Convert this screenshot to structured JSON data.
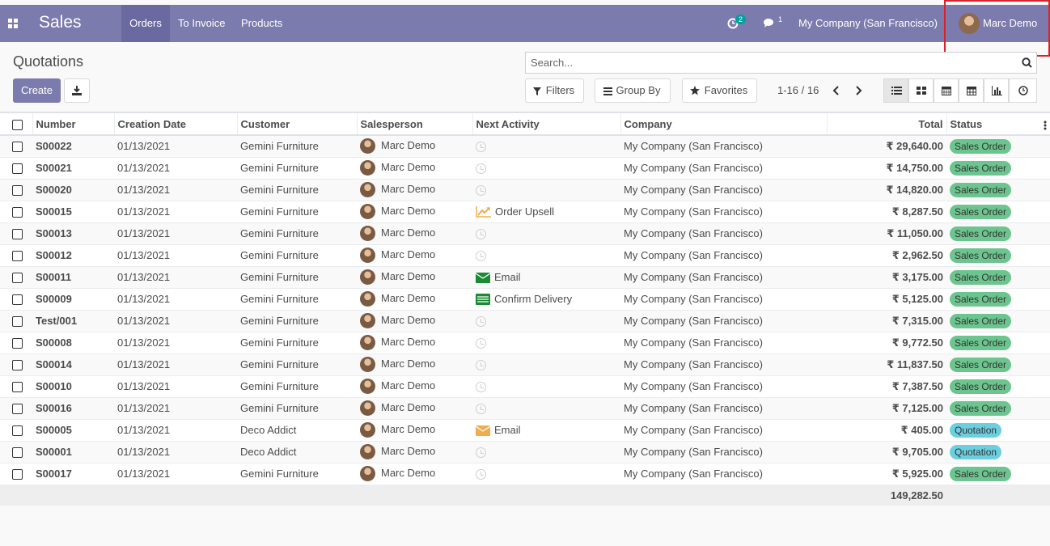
{
  "nav": {
    "app_name": "Sales",
    "menu": [
      "Orders",
      "To Invoice",
      "Products"
    ],
    "activity_count": "2",
    "message_count": "1",
    "company": "My Company (San Francisco)",
    "user": "Marc Demo"
  },
  "control": {
    "breadcrumb": "Quotations",
    "create_label": "Create",
    "search_placeholder": "Search...",
    "filters_label": "Filters",
    "groupby_label": "Group By",
    "favorites_label": "Favorites",
    "pager": "1-16 / 16"
  },
  "table": {
    "headers": [
      "Number",
      "Creation Date",
      "Customer",
      "Salesperson",
      "Next Activity",
      "Company",
      "Total",
      "Status"
    ],
    "rows": [
      {
        "number": "S00022",
        "date": "01/13/2021",
        "customer": "Gemini Furniture",
        "salesperson": "Marc Demo",
        "activity": "",
        "activity_icon": "clock-icon",
        "company": "My Company (San Francisco)",
        "total": "₹ 29,640.00",
        "status": "Sales Order"
      },
      {
        "number": "S00021",
        "date": "01/13/2021",
        "customer": "Gemini Furniture",
        "salesperson": "Marc Demo",
        "activity": "",
        "activity_icon": "clock-icon",
        "company": "My Company (San Francisco)",
        "total": "₹ 14,750.00",
        "status": "Sales Order"
      },
      {
        "number": "S00020",
        "date": "01/13/2021",
        "customer": "Gemini Furniture",
        "salesperson": "Marc Demo",
        "activity": "",
        "activity_icon": "clock-icon",
        "company": "My Company (San Francisco)",
        "total": "₹ 14,820.00",
        "status": "Sales Order"
      },
      {
        "number": "S00015",
        "date": "01/13/2021",
        "customer": "Gemini Furniture",
        "salesperson": "Marc Demo",
        "activity": "Order Upsell",
        "activity_icon": "upsell-chart-icon",
        "company": "My Company (San Francisco)",
        "total": "₹ 8,287.50",
        "status": "Sales Order"
      },
      {
        "number": "S00013",
        "date": "01/13/2021",
        "customer": "Gemini Furniture",
        "salesperson": "Marc Demo",
        "activity": "",
        "activity_icon": "clock-icon",
        "company": "My Company (San Francisco)",
        "total": "₹ 11,050.00",
        "status": "Sales Order"
      },
      {
        "number": "S00012",
        "date": "01/13/2021",
        "customer": "Gemini Furniture",
        "salesperson": "Marc Demo",
        "activity": "",
        "activity_icon": "clock-icon",
        "company": "My Company (San Francisco)",
        "total": "₹ 2,962.50",
        "status": "Sales Order"
      },
      {
        "number": "S00011",
        "date": "01/13/2021",
        "customer": "Gemini Furniture",
        "salesperson": "Marc Demo",
        "activity": "Email",
        "activity_icon": "email-green-icon",
        "company": "My Company (San Francisco)",
        "total": "₹ 3,175.00",
        "status": "Sales Order"
      },
      {
        "number": "S00009",
        "date": "01/13/2021",
        "customer": "Gemini Furniture",
        "salesperson": "Marc Demo",
        "activity": "Confirm Delivery",
        "activity_icon": "delivery-icon",
        "company": "My Company (San Francisco)",
        "total": "₹ 5,125.00",
        "status": "Sales Order"
      },
      {
        "number": "Test/001",
        "date": "01/13/2021",
        "customer": "Gemini Furniture",
        "salesperson": "Marc Demo",
        "activity": "",
        "activity_icon": "clock-icon",
        "company": "My Company (San Francisco)",
        "total": "₹ 7,315.00",
        "status": "Sales Order"
      },
      {
        "number": "S00008",
        "date": "01/13/2021",
        "customer": "Gemini Furniture",
        "salesperson": "Marc Demo",
        "activity": "",
        "activity_icon": "clock-icon",
        "company": "My Company (San Francisco)",
        "total": "₹ 9,772.50",
        "status": "Sales Order"
      },
      {
        "number": "S00014",
        "date": "01/13/2021",
        "customer": "Gemini Furniture",
        "salesperson": "Marc Demo",
        "activity": "",
        "activity_icon": "clock-icon",
        "company": "My Company (San Francisco)",
        "total": "₹ 11,837.50",
        "status": "Sales Order"
      },
      {
        "number": "S00010",
        "date": "01/13/2021",
        "customer": "Gemini Furniture",
        "salesperson": "Marc Demo",
        "activity": "",
        "activity_icon": "clock-icon",
        "company": "My Company (San Francisco)",
        "total": "₹ 7,387.50",
        "status": "Sales Order"
      },
      {
        "number": "S00016",
        "date": "01/13/2021",
        "customer": "Gemini Furniture",
        "salesperson": "Marc Demo",
        "activity": "",
        "activity_icon": "clock-icon",
        "company": "My Company (San Francisco)",
        "total": "₹ 7,125.00",
        "status": "Sales Order"
      },
      {
        "number": "S00005",
        "date": "01/13/2021",
        "customer": "Deco Addict",
        "salesperson": "Marc Demo",
        "activity": "Email",
        "activity_icon": "email-orange-icon",
        "company": "My Company (San Francisco)",
        "total": "₹ 405.00",
        "status": "Quotation"
      },
      {
        "number": "S00001",
        "date": "01/13/2021",
        "customer": "Deco Addict",
        "salesperson": "Marc Demo",
        "activity": "",
        "activity_icon": "clock-icon",
        "company": "My Company (San Francisco)",
        "total": "₹ 9,705.00",
        "status": "Quotation"
      },
      {
        "number": "S00017",
        "date": "01/13/2021",
        "customer": "Gemini Furniture",
        "salesperson": "Marc Demo",
        "activity": "",
        "activity_icon": "clock-icon",
        "company": "My Company (San Francisco)",
        "total": "₹ 5,925.00",
        "status": "Sales Order"
      }
    ],
    "footer_total": "149,282.50"
  },
  "colors": {
    "brand": "#7c7bad",
    "sales_order_pill": "#6cc58e",
    "quotation_pill": "#6ccfe0",
    "highlight": "#d9232a"
  }
}
